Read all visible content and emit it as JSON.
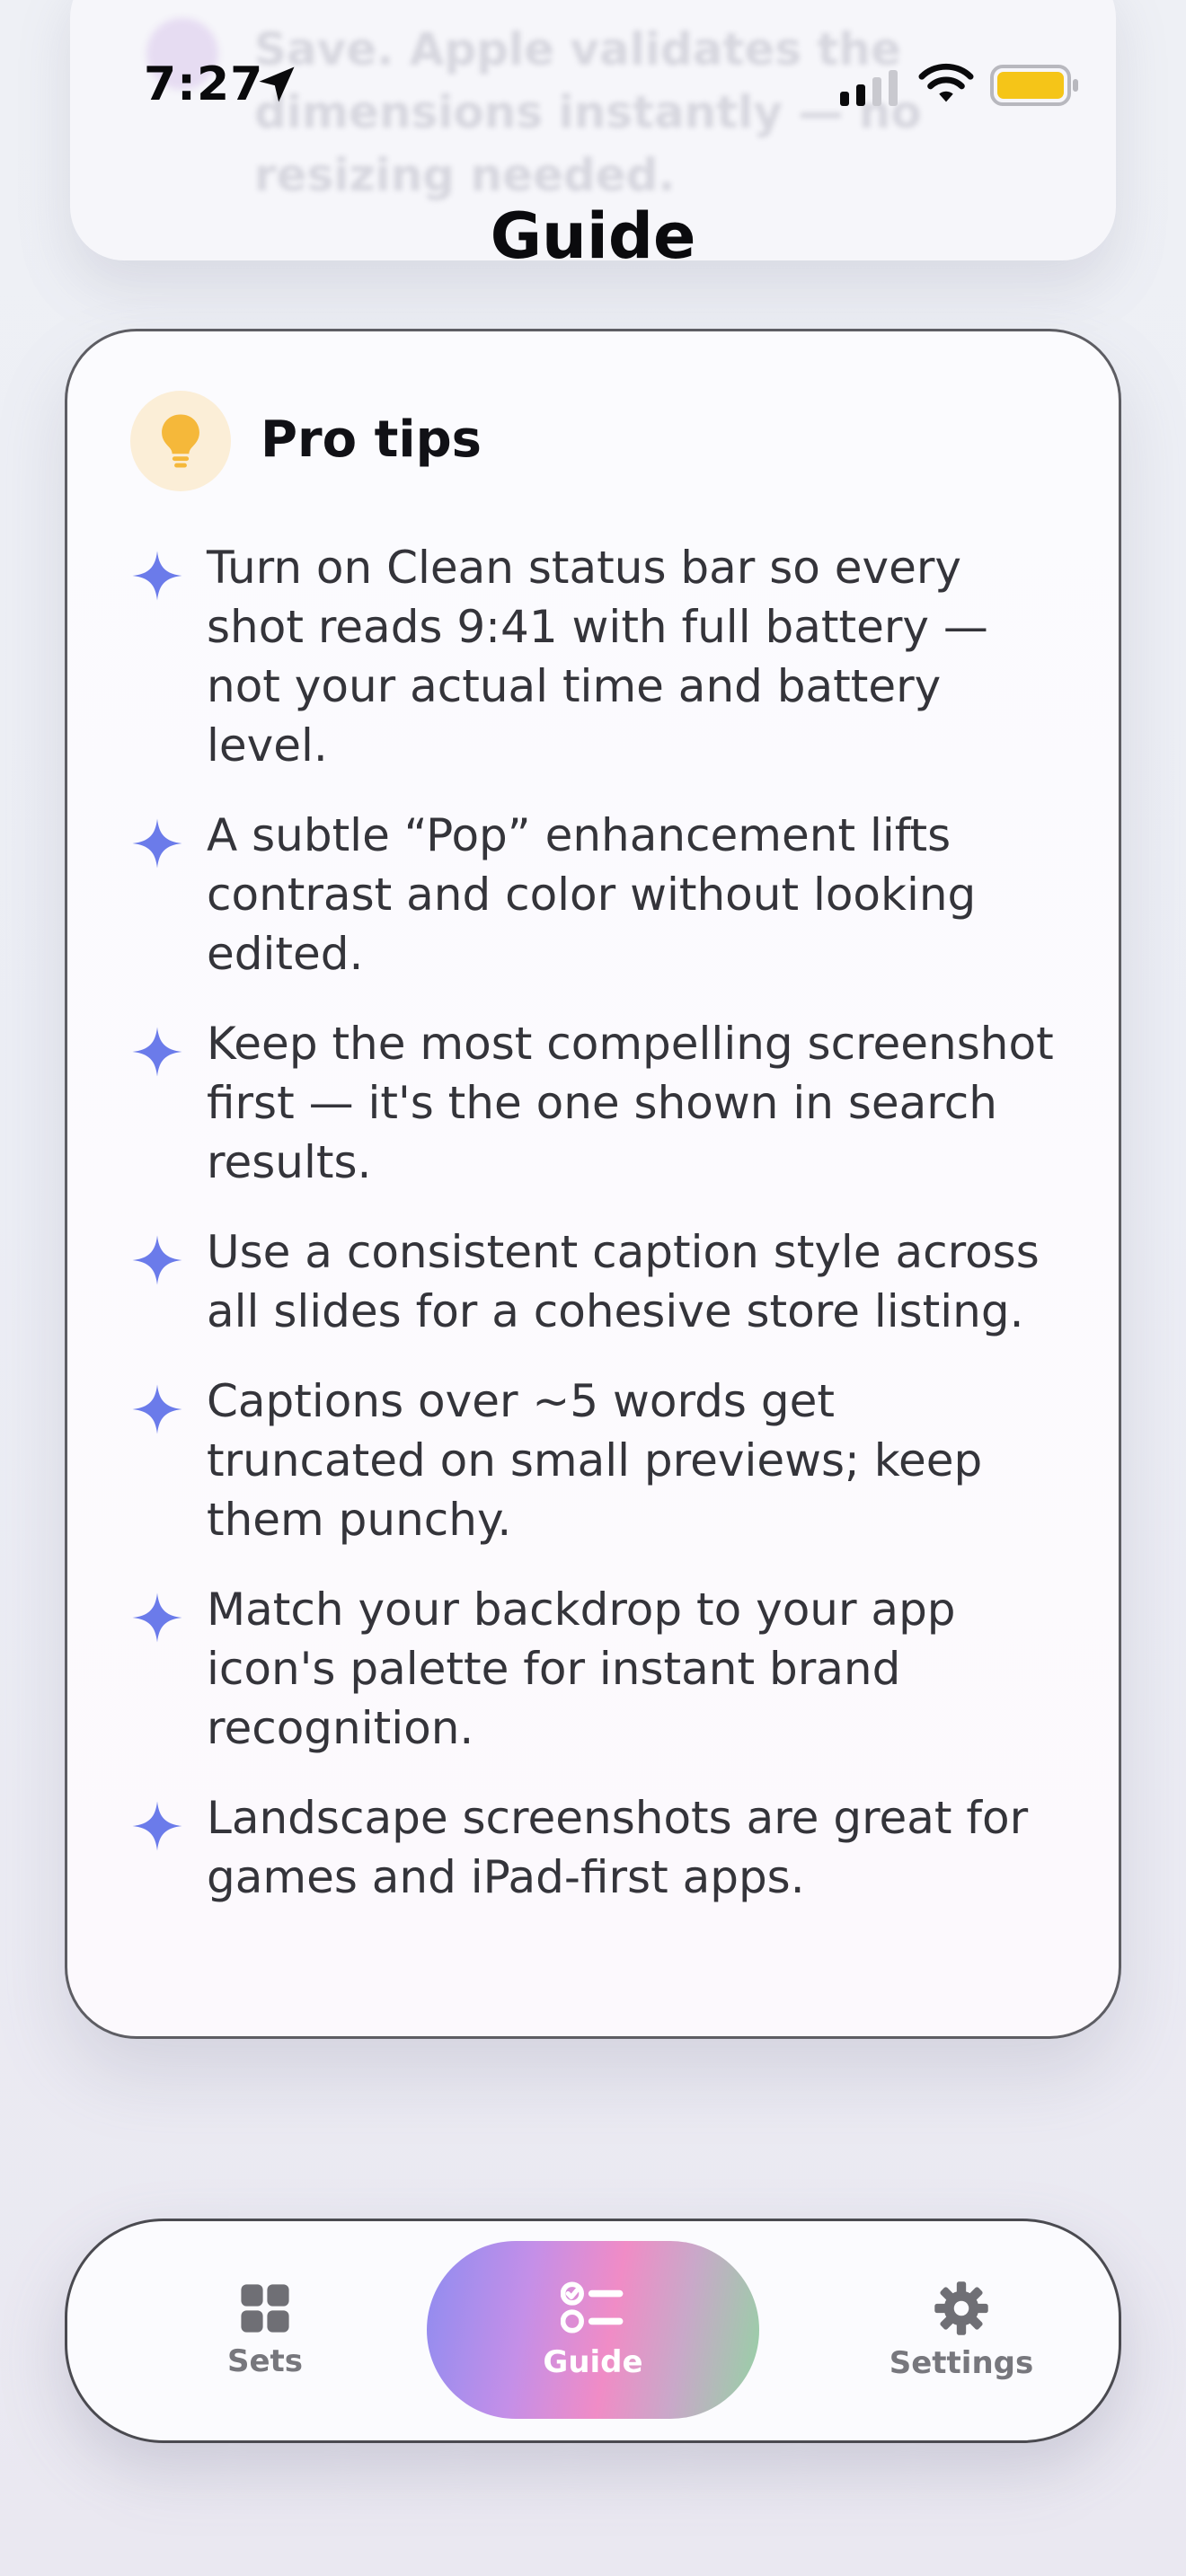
{
  "background_card": {
    "text": "Save. Apple validates the dimensions instantly — no resizing needed."
  },
  "status_bar": {
    "time": "7:27",
    "battery_color": "#F5C518"
  },
  "page": {
    "title": "Guide"
  },
  "tips_card": {
    "icon": "lightbulb-icon",
    "title": "Pro tips",
    "accent_color": "#6B7BEA",
    "items": [
      "Turn on Clean status bar so every shot reads 9:41 with full battery — not your actual time and battery level.",
      "A subtle “Pop” enhancement lifts contrast and color without looking edited.",
      "Keep the most compelling screenshot first — it's the one shown in search results.",
      "Use a consistent caption style across all slides for a cohesive store listing.",
      "Captions over ~5 words get truncated on small previews; keep them punchy.",
      "Match your backdrop to your app icon's palette for instant brand recognition.",
      "Landscape screenshots are great for games and iPad-first apps."
    ]
  },
  "tab_bar": {
    "tabs": [
      {
        "label": "Sets",
        "icon": "grid-icon",
        "selected": false
      },
      {
        "label": "Guide",
        "icon": "checklist-icon",
        "selected": true
      },
      {
        "label": "Settings",
        "icon": "gear-icon",
        "selected": false
      }
    ]
  }
}
